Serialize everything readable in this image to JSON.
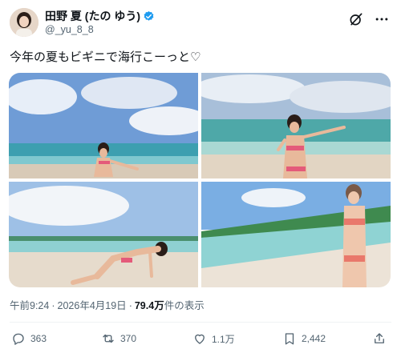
{
  "author": {
    "display_name": "田野 夏 (たの ゆう)",
    "handle": "@_yu_8_8",
    "verified": true
  },
  "header_icons": [
    "grok-icon",
    "more-icon"
  ],
  "tweet": {
    "text": "今年の夏もビギニで海行こーっと♡"
  },
  "media": {
    "count": 4,
    "images": [
      "beach-photo-1",
      "beach-photo-2",
      "beach-photo-3",
      "beach-photo-4"
    ]
  },
  "meta": {
    "time": "午前9:24",
    "separator": "·",
    "date": "2026年4月19日",
    "views_count": "79.4万",
    "views_label": "件の表示"
  },
  "actions": {
    "replies": "363",
    "reposts": "370",
    "likes": "1.1万",
    "bookmarks": "2,442"
  },
  "colors": {
    "text": "#0f1419",
    "secondary": "#536471",
    "verified": "#1d9bf0",
    "divider": "#eff3f4"
  }
}
